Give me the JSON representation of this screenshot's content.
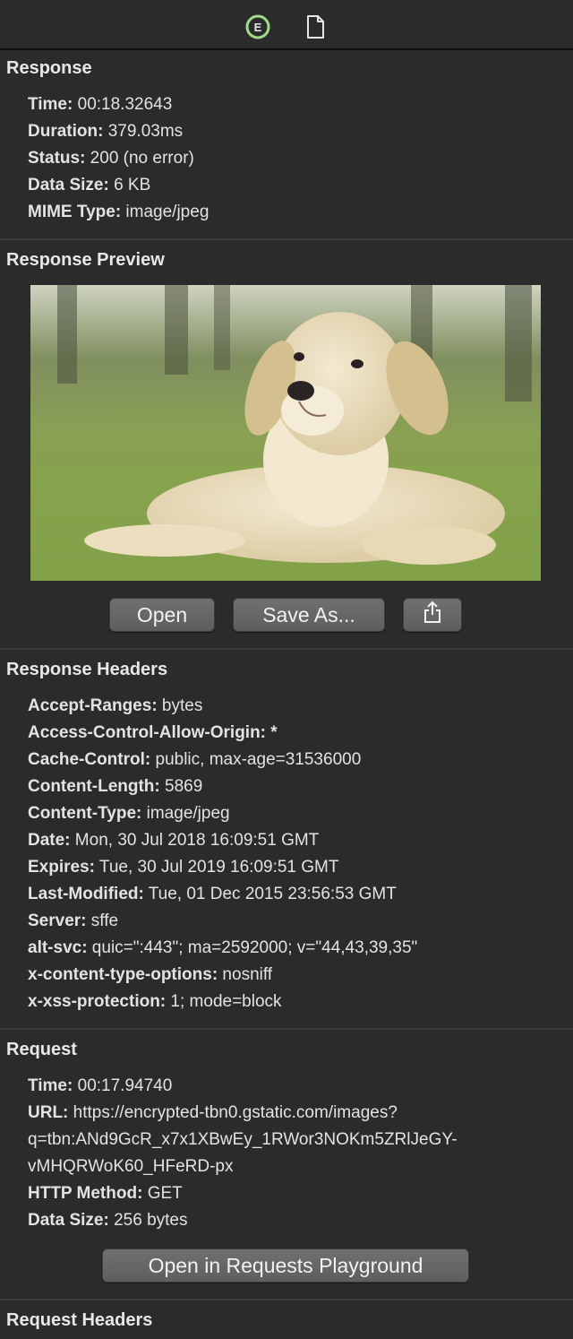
{
  "toolbar": {
    "icons": [
      "e-circle-icon",
      "document-icon"
    ]
  },
  "response": {
    "title": "Response",
    "rows": [
      {
        "k": "Time:",
        "v": " 00:18.32643"
      },
      {
        "k": "Duration:",
        "v": " 379.03ms"
      },
      {
        "k": "Status:",
        "v": " 200 (no error)"
      },
      {
        "k": "Data Size:",
        "v": " 6 KB"
      },
      {
        "k": "MIME Type:",
        "v": " image/jpeg"
      }
    ]
  },
  "preview": {
    "title": "Response Preview",
    "open_label": "Open",
    "save_label": "Save As..."
  },
  "response_headers": {
    "title": "Response Headers",
    "rows": [
      {
        "k": "Accept-Ranges:",
        "v": " bytes"
      },
      {
        "k": "Access-Control-Allow-Origin:",
        "v": " *"
      },
      {
        "k": "Cache-Control:",
        "v": " public, max-age=31536000"
      },
      {
        "k": "Content-Length:",
        "v": " 5869"
      },
      {
        "k": "Content-Type:",
        "v": " image/jpeg"
      },
      {
        "k": "Date:",
        "v": " Mon, 30 Jul 2018 16:09:51 GMT"
      },
      {
        "k": "Expires:",
        "v": " Tue, 30 Jul 2019 16:09:51 GMT"
      },
      {
        "k": "Last-Modified:",
        "v": " Tue, 01 Dec 2015 23:56:53 GMT"
      },
      {
        "k": "Server:",
        "v": " sffe"
      },
      {
        "k": "alt-svc:",
        "v": " quic=\":443\"; ma=2592000; v=\"44,43,39,35\""
      },
      {
        "k": "x-content-type-options:",
        "v": " nosniff"
      },
      {
        "k": "x-xss-protection:",
        "v": " 1; mode=block"
      }
    ]
  },
  "request": {
    "title": "Request",
    "time_k": "Time:",
    "time_v": " 00:17.94740",
    "url_k": "URL:",
    "url_v": " https://encrypted-tbn0.gstatic.com/images?",
    "url_line2": "q=tbn:ANd9GcR_x7x1XBwEy_1RWor3NOKm5ZRlJeGY-",
    "url_line3": "vMHQRWoK60_HFeRD-px",
    "method_k": "HTTP Method:",
    "method_v": " GET",
    "size_k": "Data Size:",
    "size_v": " 256 bytes",
    "playground_label": "Open in Requests Playground"
  },
  "request_headers": {
    "title": "Request Headers"
  }
}
